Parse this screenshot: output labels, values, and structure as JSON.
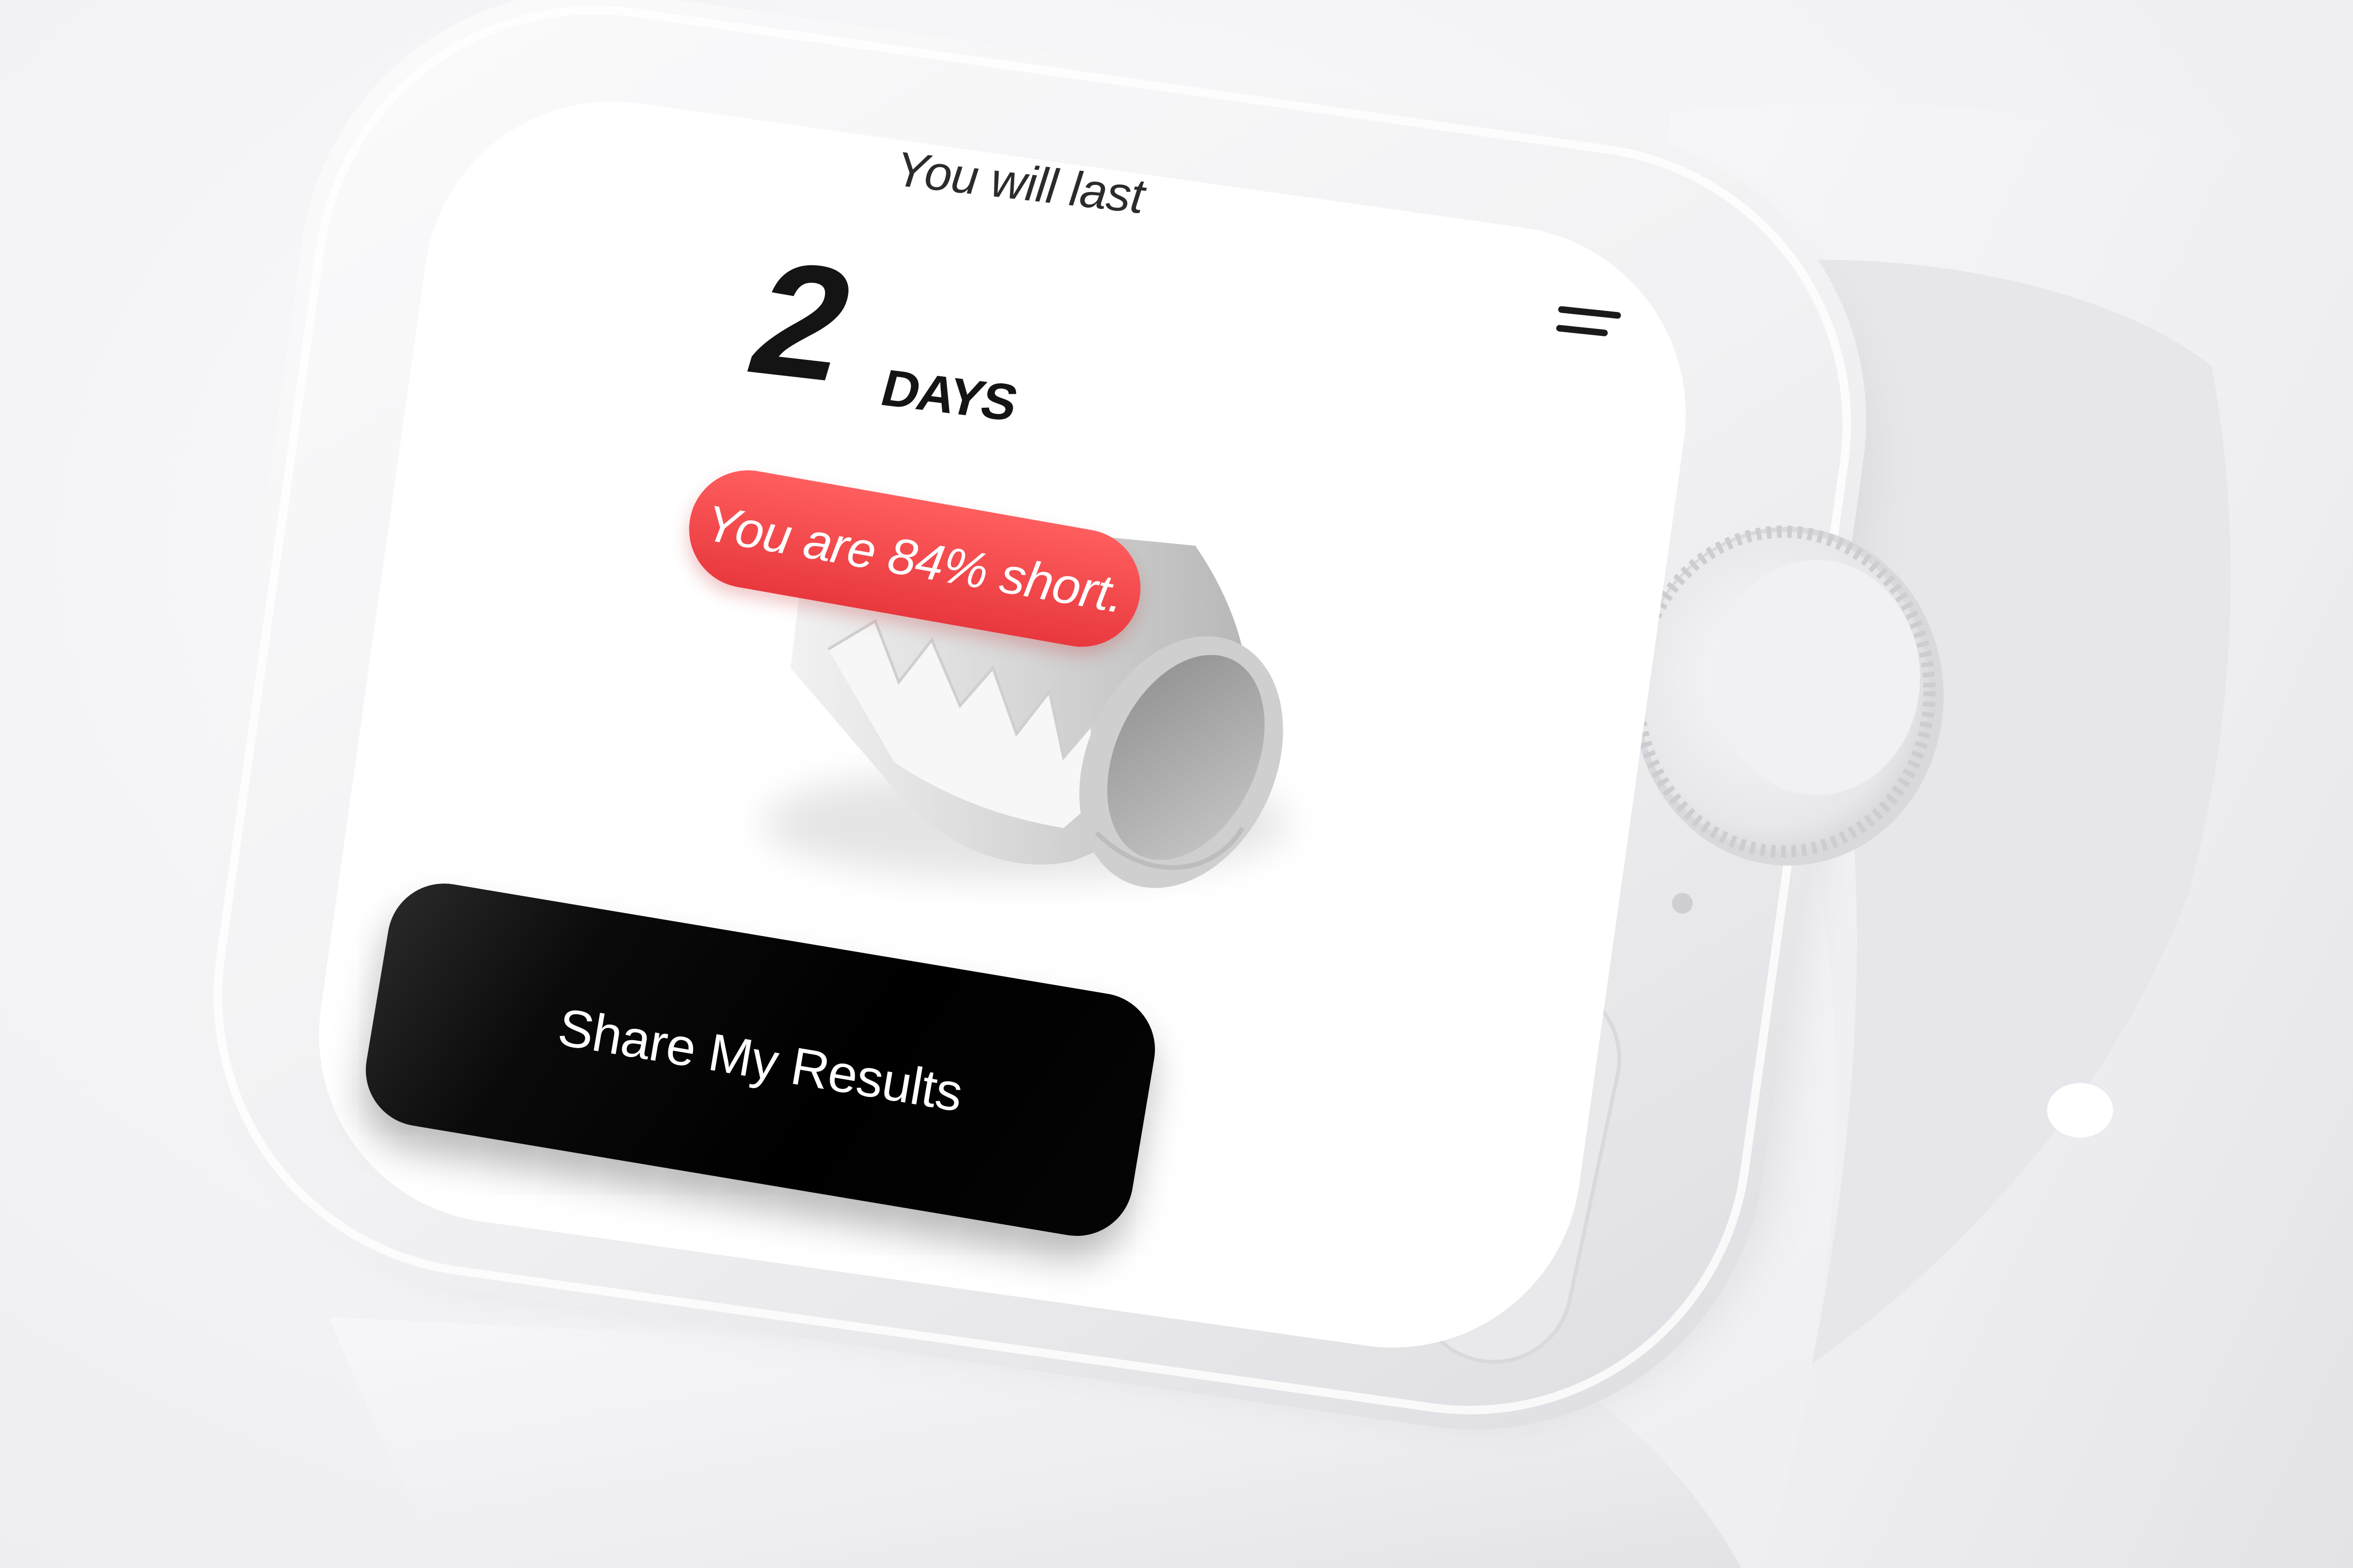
{
  "screen": {
    "heading": "You will last",
    "value": "2",
    "unit": "DAYS",
    "badge": "You are 84% short.",
    "share_button": "Share My Results"
  },
  "icons": {
    "menu": "menu-icon"
  },
  "colors": {
    "background": "#f2f2f5",
    "device": "#f4f4f6",
    "screen": "#ffffff",
    "badge": "#ee4045",
    "button": "#000000",
    "text_dark": "#141414"
  }
}
